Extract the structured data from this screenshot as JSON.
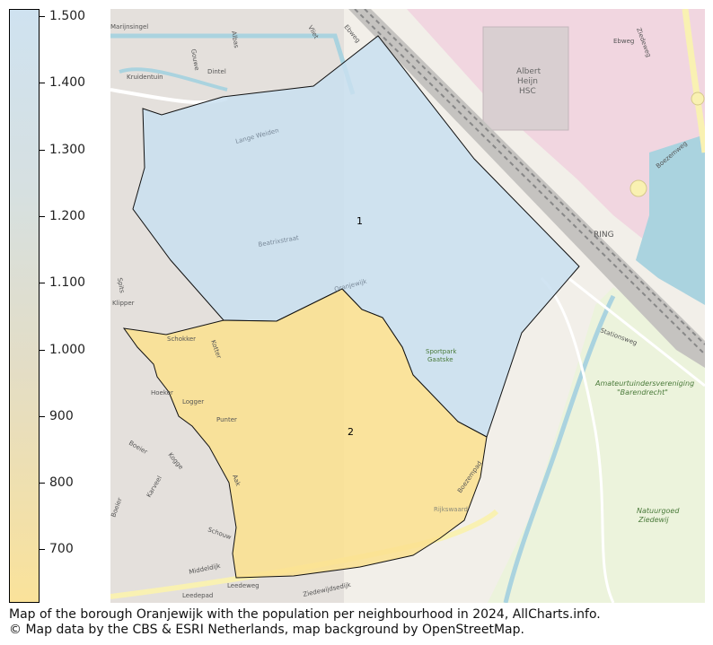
{
  "legend": {
    "ticks": [
      "1.500",
      "1.400",
      "1.300",
      "1.200",
      "1.100",
      "1.000",
      "900",
      "800",
      "700"
    ],
    "color_high": "#cfe2f0",
    "color_low": "#fae29a"
  },
  "map": {
    "neighbourhoods": [
      {
        "label": "1",
        "population": 1500,
        "color": "#c9dff0"
      },
      {
        "label": "2",
        "population": 640,
        "color": "#fbe18e"
      }
    ],
    "place_labels": {
      "albert_heijn": "Albert",
      "albert_heijn2": "Heijn",
      "albert_heijn3": "HSC",
      "ring": "RING",
      "amateur1": "Amateurtuindersvereniging",
      "amateur2": "\"Barendrecht\"",
      "natuur1": "Natuurgoed",
      "natuur2": "Ziedewij",
      "sportpark1": "Sportpark",
      "sportpark2": "Gaatske"
    },
    "street_labels": {
      "s1": "Ebweg",
      "s2": "Ziedeweg",
      "s3": "Boezemweg",
      "s4": "Stationsweg",
      "s5": "Middeldijk",
      "s6": "Leedeweg",
      "s7": "Leedepad",
      "s8": "Ziedewijdsedijk",
      "s9": "Boeier",
      "s10": "Kogge",
      "s11": "Punter",
      "s12": "Logger",
      "s13": "Hoeker",
      "s14": "Schokker",
      "s15": "Kotter",
      "s16": "Kruidentuin",
      "s17": "Dintel",
      "s18": "Gouwe",
      "s19": "Boezempad",
      "s20": "Schouw",
      "s21": "Aak",
      "s22": "Karveel",
      "s23": "Boeier",
      "s24": "Spits",
      "s25": "Klipper",
      "s26": "Albas",
      "s27": "Vliet",
      "s28": "Ebweg",
      "s29": "Lange Weiden",
      "s30": "Beatrixstraat",
      "s31": "Oranjewijk",
      "s32": "Marijnsingel",
      "s33": "Rijkswaard"
    }
  },
  "caption": {
    "line1": "Map of the borough Oranjewijk with the population per neighbourhood in 2024, AllCharts.info.",
    "line2": "© Map data by the CBS & ESRI Netherlands, map background by OpenStreetMap."
  }
}
